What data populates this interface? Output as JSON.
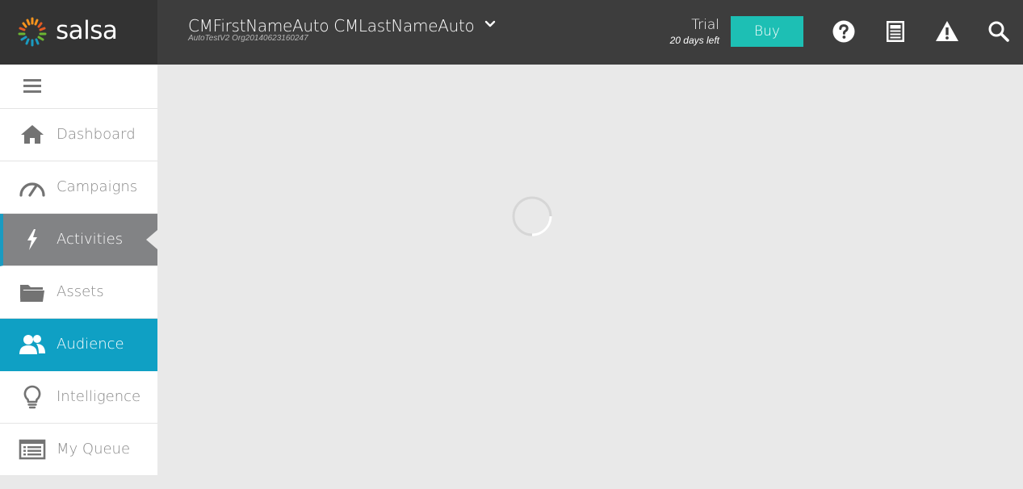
{
  "brand": {
    "name": "salsa",
    "logo_icon": "salsa-logo-icon",
    "colors": [
      "#f7941d",
      "#1a9bc1",
      "#6bb533",
      "#e25b23"
    ]
  },
  "header": {
    "user_name": "CMFirstNameAuto CMLastNameAuto",
    "org_name": "AutoTestV2 Org20140623160247",
    "dropdown_icon": "chevron-down-icon",
    "trial_label": "Trial",
    "trial_days": "20 days left",
    "buy_label": "Buy",
    "buy_color": "#1dbfb4",
    "icons": [
      "help-icon",
      "news-icon",
      "alert-icon",
      "search-icon"
    ]
  },
  "sidebar": {
    "toggle_icon": "hamburger-icon",
    "items": [
      {
        "label": "Dashboard",
        "icon": "home-icon",
        "state": "normal"
      },
      {
        "label": "Campaigns",
        "icon": "gauge-icon",
        "state": "normal"
      },
      {
        "label": "Activities",
        "icon": "lightning-icon",
        "state": "hover"
      },
      {
        "label": "Assets",
        "icon": "folder-icon",
        "state": "normal"
      },
      {
        "label": "Audience",
        "icon": "users-icon",
        "state": "selected"
      },
      {
        "label": "Intelligence",
        "icon": "lightbulb-icon",
        "state": "normal"
      },
      {
        "label": "My Queue",
        "icon": "queue-icon",
        "state": "normal"
      }
    ],
    "selected_color": "#0fa0c4",
    "hover_color": "#828385"
  },
  "main": {
    "loading_icon": "loading-spinner-icon"
  }
}
